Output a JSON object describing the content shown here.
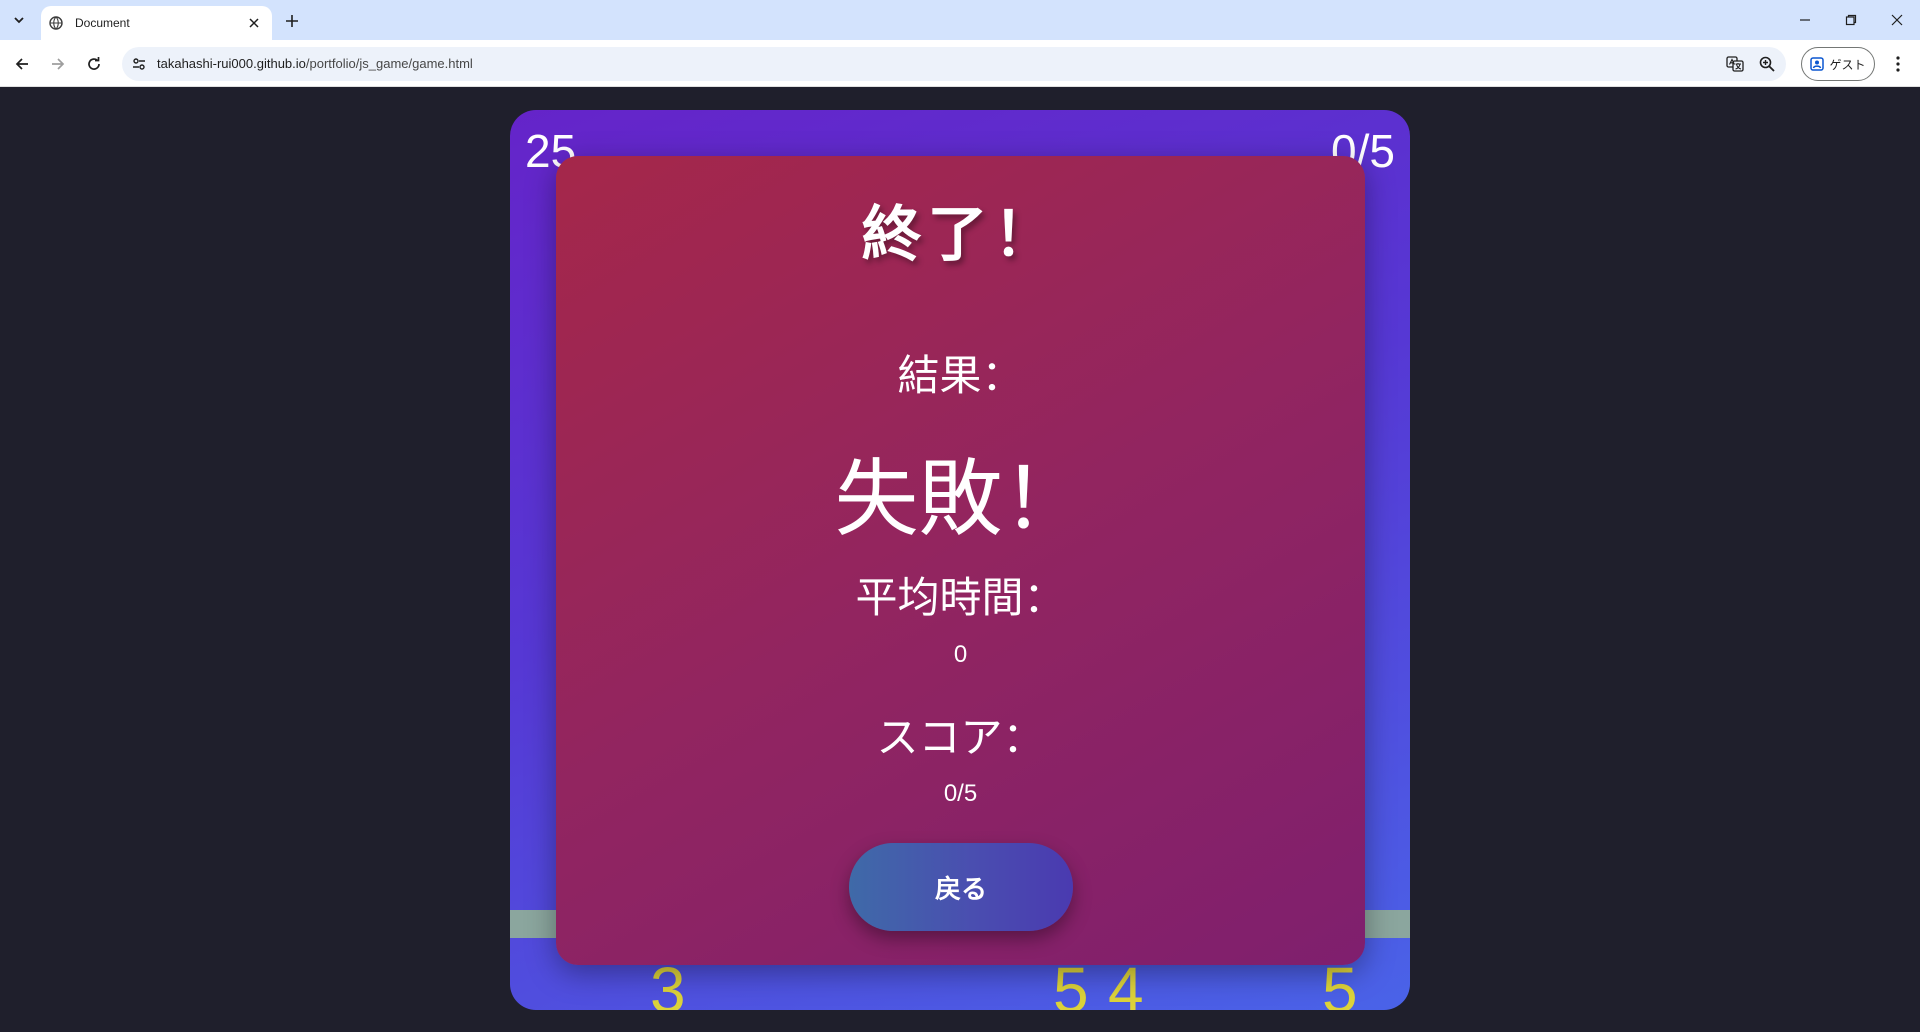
{
  "browser": {
    "tab_title": "Document",
    "url_host": "takahashi-rui000.github.io",
    "url_path": "/portfolio/js_game/game.html",
    "profile_label": "ゲスト"
  },
  "game": {
    "timer": "25",
    "score_corner": "0/5",
    "falling_numbers": [
      "3",
      "5",
      "4",
      "5"
    ],
    "colors": {
      "background_gradient": [
        "#6524c9",
        "#4a63e8"
      ],
      "ground": "#8ba69e",
      "falling_number": "#ddd33a"
    }
  },
  "result": {
    "title": "終了！",
    "result_label": "結果：",
    "result_value": "失敗！",
    "avg_time_label": "平均時間：",
    "avg_time_value": "0",
    "score_label": "スコア：",
    "score_value": "0/5",
    "back_button": "戻る",
    "colors": {
      "panel_gradient": [
        "#a5274a",
        "#7f1f6e"
      ],
      "button_gradient": [
        "#3f6aa8",
        "#4a3ab0"
      ]
    }
  },
  "icons": [
    "tab-search-icon",
    "globe-icon",
    "close-icon",
    "new-tab-icon",
    "minimize-icon",
    "restore-icon",
    "window-close-icon",
    "back-icon",
    "forward-icon",
    "reload-icon",
    "site-settings-icon",
    "translate-icon",
    "zoom-icon",
    "profile-icon",
    "menu-icon"
  ]
}
